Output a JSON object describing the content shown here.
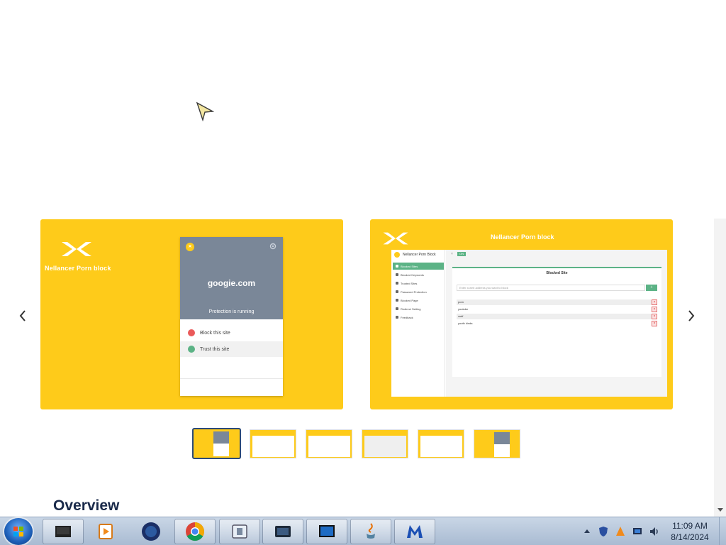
{
  "carousel": {
    "prev_icon": "chevron-left-icon",
    "next_icon": "chevron-right-icon",
    "slide1": {
      "title": "Nellancer Porn block",
      "popup": {
        "domain": "googie.com",
        "status": "Protection is running",
        "block_label": "Block this site",
        "trust_label": "Trust this site"
      }
    },
    "slide2": {
      "title": "Nellancer Porn block",
      "app_title": "Nellancer Porn Block",
      "sidebar_items": [
        "Blocked Sites",
        "Blocked Keywords",
        "Trusted Sites",
        "Password Protection",
        "Blocked Page",
        "Redirect Setting",
        "Feedback"
      ],
      "panel_title": "Blocked Site",
      "input_placeholder": "Enter a web address you want to block",
      "add_button": "+",
      "sites": [
        "porn",
        "youtube",
        "vsdf",
        "youth kinda"
      ],
      "delete_symbol": "×"
    }
  },
  "thumbnails_count": 6,
  "section_heading": "Overview",
  "colors": {
    "slide_bg": "#fecb1a",
    "accent_green": "#5cb386",
    "popup_header": "#7a8798",
    "heading": "#1a2a4a"
  },
  "taskbar": {
    "apps": [
      "mediacenter",
      "media-player",
      "firefox-dark",
      "chrome",
      "app-window",
      "screen-capture",
      "monitor-app",
      "java",
      "malwarebytes"
    ],
    "clock": {
      "time": "11:09 AM",
      "date": "8/14/2024"
    }
  }
}
